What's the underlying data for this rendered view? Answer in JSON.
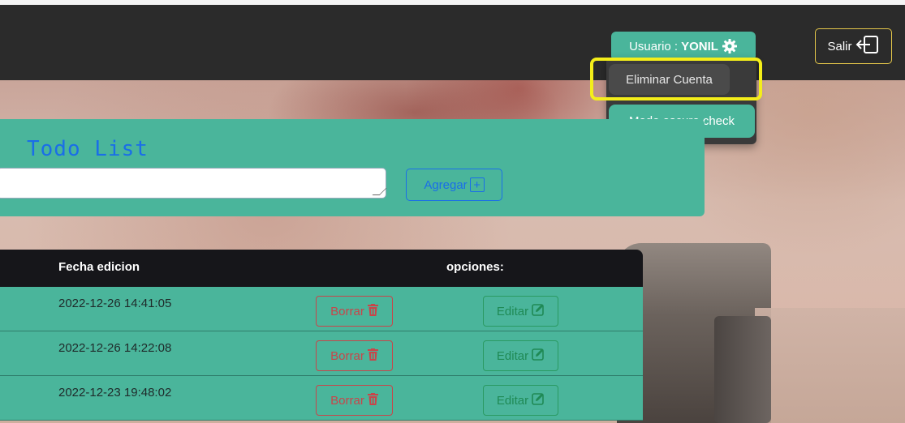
{
  "header": {
    "user_label": "Usuario :",
    "username": "YONIL",
    "logout_label": "Salir"
  },
  "user_menu": {
    "items": [
      {
        "label": "Eliminar Cuenta",
        "highlighted": true
      },
      {
        "label": "Modo oscuro check",
        "highlighted": false
      }
    ]
  },
  "todo": {
    "title": "Todo List",
    "input_value": "",
    "add_label": "Agregar"
  },
  "table": {
    "headers": {
      "date": "Fecha edicion",
      "options": "opciones:"
    },
    "rows": [
      {
        "date": "2022-12-26 14:41:05",
        "delete_label": "Borrar",
        "edit_label": "Editar"
      },
      {
        "date": "2022-12-26 14:22:08",
        "delete_label": "Borrar",
        "edit_label": "Editar"
      },
      {
        "date": "2022-12-23 19:48:02",
        "delete_label": "Borrar",
        "edit_label": "Editar"
      }
    ]
  },
  "colors": {
    "accent": "#4ab59b",
    "navbar": "#2b2b2b",
    "highlight": "#f4ee1a",
    "danger": "#c8454a",
    "success": "#1f8a55",
    "primary": "#1a6ee8"
  },
  "icons": {
    "settings": "gear-icon",
    "logout": "logout-icon",
    "add": "plus-square-icon",
    "delete": "trash-icon",
    "edit": "edit-icon"
  }
}
